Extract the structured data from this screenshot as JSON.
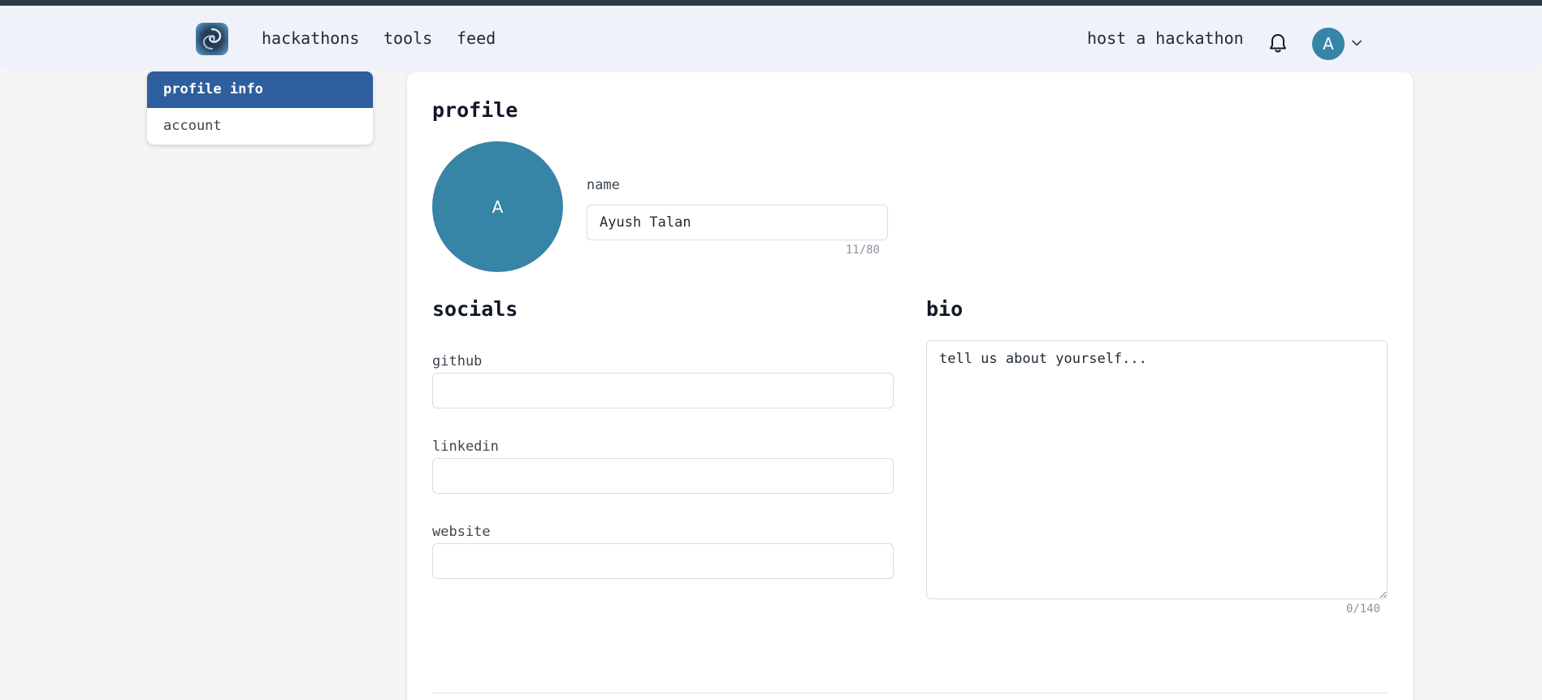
{
  "nav": {
    "logo_name": "swirl-logo",
    "links": [
      "hackathons",
      "tools",
      "feed"
    ],
    "host_label": "host a hackathon",
    "avatar_initial": "A"
  },
  "sidebar": {
    "items": [
      {
        "label": "profile info",
        "active": true
      },
      {
        "label": "account",
        "active": false
      }
    ]
  },
  "profile": {
    "title": "profile",
    "avatar_initial": "A",
    "name_label": "name",
    "name_value": "Ayush Talan",
    "name_counter": "11/80"
  },
  "socials": {
    "title": "socials",
    "github_label": "github",
    "github_value": "",
    "linkedin_label": "linkedin",
    "linkedin_value": "",
    "website_label": "website",
    "website_value": ""
  },
  "bio": {
    "title": "bio",
    "placeholder": "tell us about yourself...",
    "counter": "0/140"
  },
  "colors": {
    "accent": "#2e5e9e",
    "avatar": "#3684a6",
    "header_bg": "#f0f2fa",
    "top_strip": "#2b3b45"
  }
}
